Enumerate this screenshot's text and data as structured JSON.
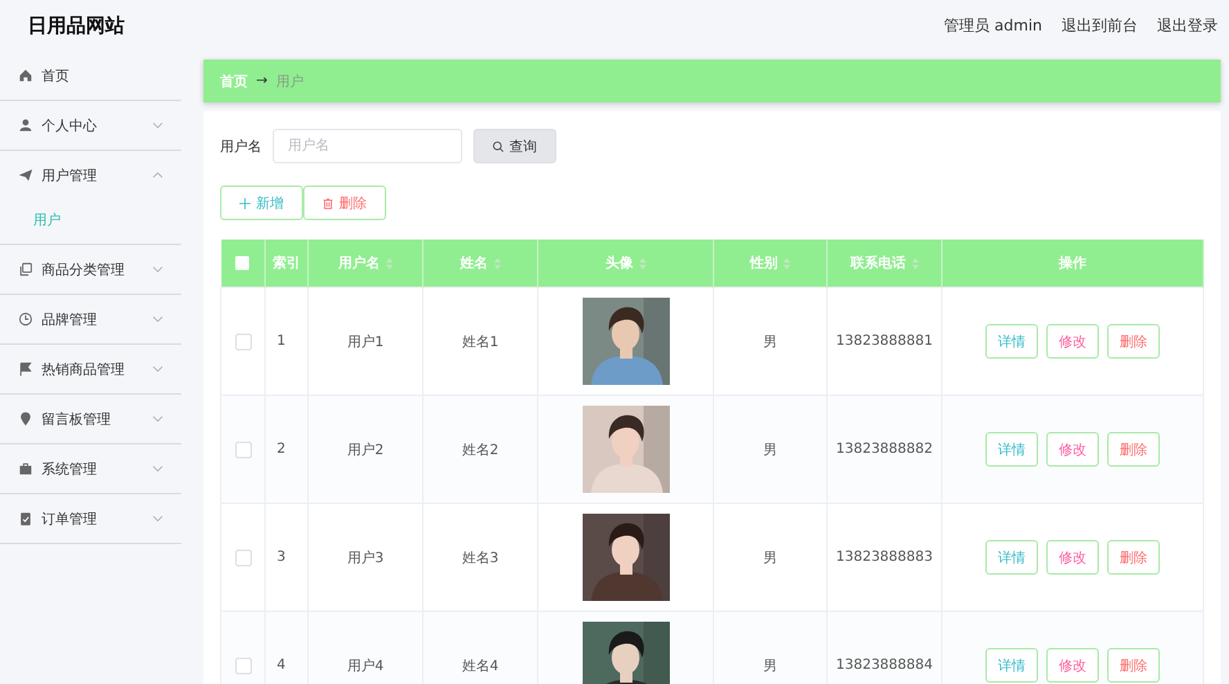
{
  "site_title": "日用品网站",
  "admin_label": "管理员 admin",
  "header_links": [
    "退出到前台",
    "退出登录"
  ],
  "sidebar": {
    "items": [
      {
        "label": "首页",
        "expandable": false,
        "expanded": false
      },
      {
        "label": "个人中心",
        "expandable": true,
        "expanded": false
      },
      {
        "label": "用户管理",
        "expandable": true,
        "expanded": true,
        "children": [
          {
            "label": "用户",
            "selected": true
          }
        ]
      },
      {
        "label": "商品分类管理",
        "expandable": true,
        "expanded": false
      },
      {
        "label": "品牌管理",
        "expandable": true,
        "expanded": false
      },
      {
        "label": "热销商品管理",
        "expandable": true,
        "expanded": false
      },
      {
        "label": "留言板管理",
        "expandable": true,
        "expanded": false
      },
      {
        "label": "系统管理",
        "expandable": true,
        "expanded": false
      },
      {
        "label": "订单管理",
        "expandable": true,
        "expanded": false
      }
    ]
  },
  "breadcrumb": [
    {
      "label": "首页",
      "selected": false
    },
    {
      "label": "→",
      "kind": "separator"
    },
    {
      "label": "用户",
      "selected": true
    }
  ],
  "search": {
    "label": "用户名",
    "placeholder": "用户名",
    "button": "查询"
  },
  "actions": [
    {
      "kind": "add",
      "label": "新增"
    },
    {
      "kind": "delete",
      "label": "删除"
    }
  ],
  "table": {
    "select_all": {
      "checked": false
    },
    "columns": [
      {
        "label": "索引",
        "sortable": false
      },
      {
        "label": "用户名",
        "sortable": true
      },
      {
        "label": "姓名",
        "sortable": true
      },
      {
        "label": "头像",
        "sortable": true
      },
      {
        "label": "性别",
        "sortable": true
      },
      {
        "label": "联系电话",
        "sortable": true
      },
      {
        "label": "操作",
        "sortable": false
      }
    ],
    "rows": [
      {
        "checked": false,
        "index": "1",
        "username": "用户1",
        "name": "姓名1",
        "avatar": {
          "kind": "picture"
        },
        "gender": "男",
        "phone": "13823888881",
        "buttons": [
          {
            "kind": "detail",
            "label": "详情"
          },
          {
            "kind": "edit",
            "label": "修改"
          },
          {
            "kind": "delete",
            "label": "删除"
          }
        ]
      },
      {
        "checked": false,
        "index": "2",
        "username": "用户2",
        "name": "姓名2",
        "avatar": {
          "kind": "picture"
        },
        "gender": "男",
        "phone": "13823888882",
        "buttons": [
          {
            "kind": "detail",
            "label": "详情"
          },
          {
            "kind": "edit",
            "label": "修改"
          },
          {
            "kind": "delete",
            "label": "删除"
          }
        ]
      },
      {
        "checked": false,
        "index": "3",
        "username": "用户3",
        "name": "姓名3",
        "avatar": {
          "kind": "picture"
        },
        "gender": "男",
        "phone": "13823888883",
        "buttons": [
          {
            "kind": "detail",
            "label": "详情"
          },
          {
            "kind": "edit",
            "label": "修改"
          },
          {
            "kind": "delete",
            "label": "删除"
          }
        ]
      },
      {
        "checked": false,
        "index": "4",
        "username": "用户4",
        "name": "姓名4",
        "avatar": {
          "kind": "picture"
        },
        "gender": "男",
        "phone": "13823888884",
        "buttons": [
          {
            "kind": "detail",
            "label": "详情"
          },
          {
            "kind": "edit",
            "label": "修改"
          },
          {
            "kind": "delete",
            "label": "删除"
          }
        ]
      }
    ]
  }
}
